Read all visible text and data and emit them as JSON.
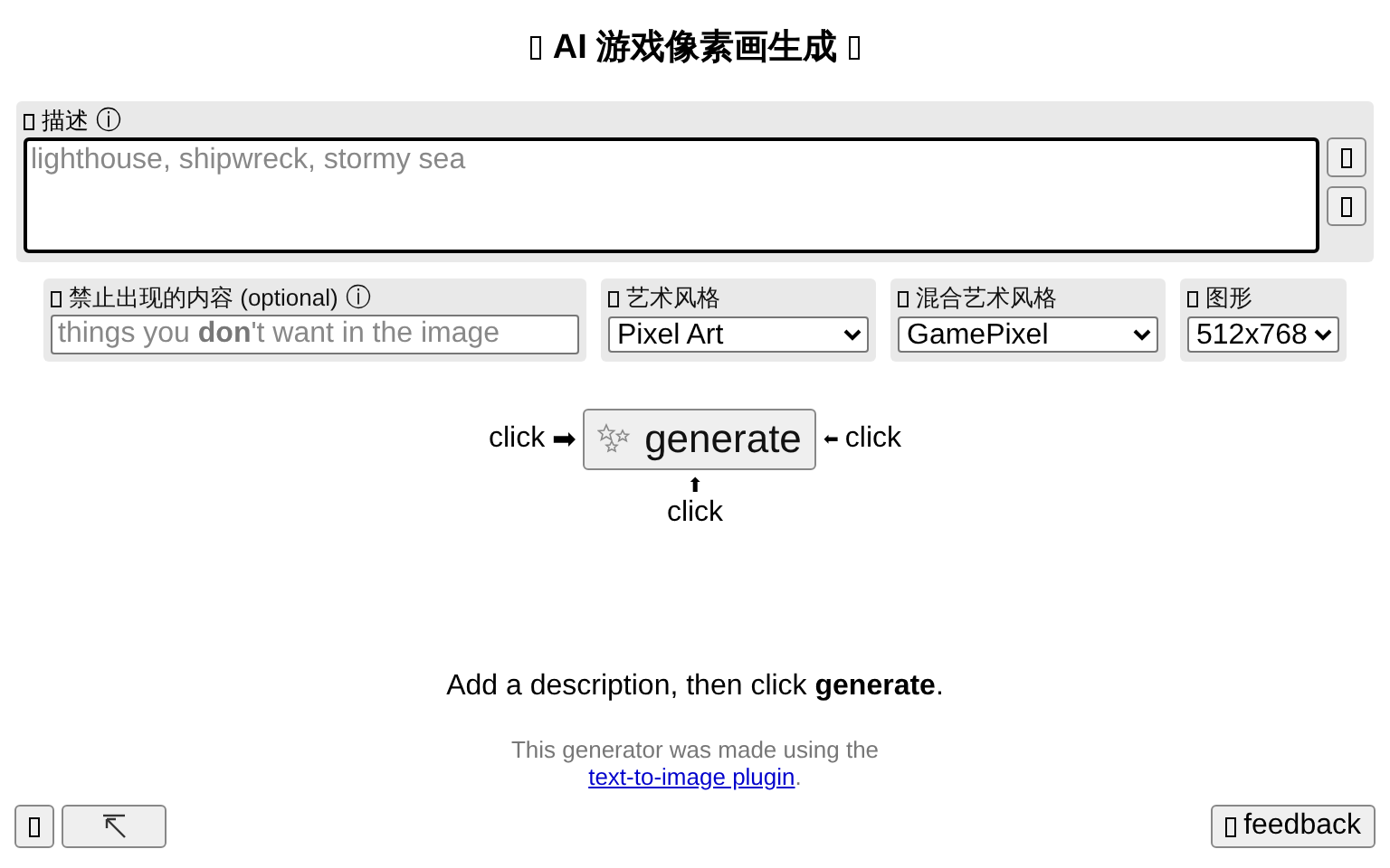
{
  "title": "AI 游戏像素画生成",
  "description": {
    "label": "描述",
    "info": "ⓘ",
    "placeholder": "lighthouse, shipwreck, stormy sea"
  },
  "options": [
    {
      "kind": "text",
      "label": "禁止出现的内容 (optional)",
      "info": "ⓘ",
      "placeholder": "things you **don**'t want in the image"
    },
    {
      "kind": "select",
      "label": "艺术风格",
      "value": "Pixel Art"
    },
    {
      "kind": "select",
      "label": "混合艺术风格",
      "value": "GamePixel"
    },
    {
      "kind": "select",
      "label": "图形",
      "value": "512x768"
    }
  ],
  "generate": {
    "label": "generate",
    "left_hint": "click",
    "left_arrow": "➡",
    "right_arrow": "⬅",
    "right_hint": "click",
    "bottom_arrow": "⬆",
    "bottom_hint": "click"
  },
  "message": "Add a description, then click **generate**.",
  "credit": {
    "text": "This generator was made using the",
    "link": "text-to-image plugin",
    "after": "."
  },
  "footer": {
    "feedback": "feedback"
  }
}
